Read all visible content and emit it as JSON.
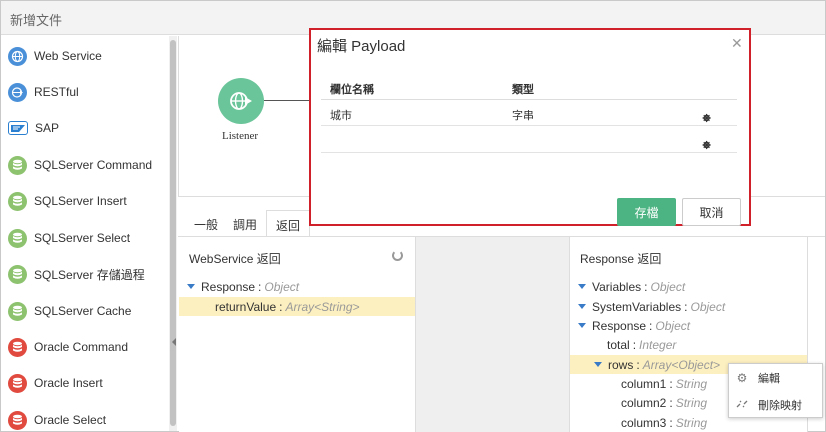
{
  "window": {
    "title": "新增文件"
  },
  "sidebar": {
    "items": [
      {
        "label": "Web Service",
        "icon": "globe-icon",
        "color": "#4a90d9"
      },
      {
        "label": "RESTful",
        "icon": "globe-arrow-icon",
        "color": "#4a90d9"
      },
      {
        "label": "SAP",
        "icon": "sap-icon",
        "color": "#2a7fd0"
      },
      {
        "label": "SQLServer Command",
        "icon": "database-icon",
        "color": "#8dc26f"
      },
      {
        "label": "SQLServer Insert",
        "icon": "database-icon",
        "color": "#8dc26f"
      },
      {
        "label": "SQLServer Select",
        "icon": "database-icon",
        "color": "#8dc26f"
      },
      {
        "label": "SQLServer 存儲過程",
        "icon": "database-icon",
        "color": "#8dc26f"
      },
      {
        "label": "SQLServer Cache",
        "icon": "database-icon",
        "color": "#8dc26f"
      },
      {
        "label": "Oracle Command",
        "icon": "database-icon",
        "color": "#e04a3f"
      },
      {
        "label": "Oracle Insert",
        "icon": "database-icon",
        "color": "#e04a3f"
      },
      {
        "label": "Oracle Select",
        "icon": "database-icon",
        "color": "#e04a3f"
      }
    ]
  },
  "canvas": {
    "node_label": "Listener",
    "node_color": "#6bc59a"
  },
  "tabs": [
    {
      "label": "一般"
    },
    {
      "label": "調用"
    },
    {
      "label": "返回",
      "active": true
    }
  ],
  "left_panel": {
    "title": "WebService 返回",
    "tree": [
      {
        "name": "Response",
        "type": "Object"
      },
      {
        "name": "returnValue",
        "type": "Array<String>"
      }
    ]
  },
  "right_panel": {
    "title": "Response 返回",
    "tree": [
      {
        "name": "Variables",
        "type": "Object"
      },
      {
        "name": "SystemVariables",
        "type": "Object"
      },
      {
        "name": "Response",
        "type": "Object"
      },
      {
        "name": "total",
        "type": "Integer"
      },
      {
        "name": "rows",
        "type": "Array<Object>"
      },
      {
        "name": "column1",
        "type": "String"
      },
      {
        "name": "column2",
        "type": "String"
      },
      {
        "name": "column3",
        "type": "String"
      }
    ]
  },
  "context_menu": {
    "items": [
      {
        "label": "編輯",
        "icon": "gear-icon"
      },
      {
        "label": "刪除映射",
        "icon": "unlink-icon"
      }
    ]
  },
  "modal": {
    "title": "編輯 Payload",
    "columns": {
      "name": "欄位名稱",
      "type": "類型"
    },
    "rows": [
      {
        "name": "城市",
        "type": "字串"
      },
      {
        "name": "",
        "type": ""
      }
    ],
    "save_label": "存檔",
    "cancel_label": "取消",
    "highlight_color": "#d0212a"
  }
}
